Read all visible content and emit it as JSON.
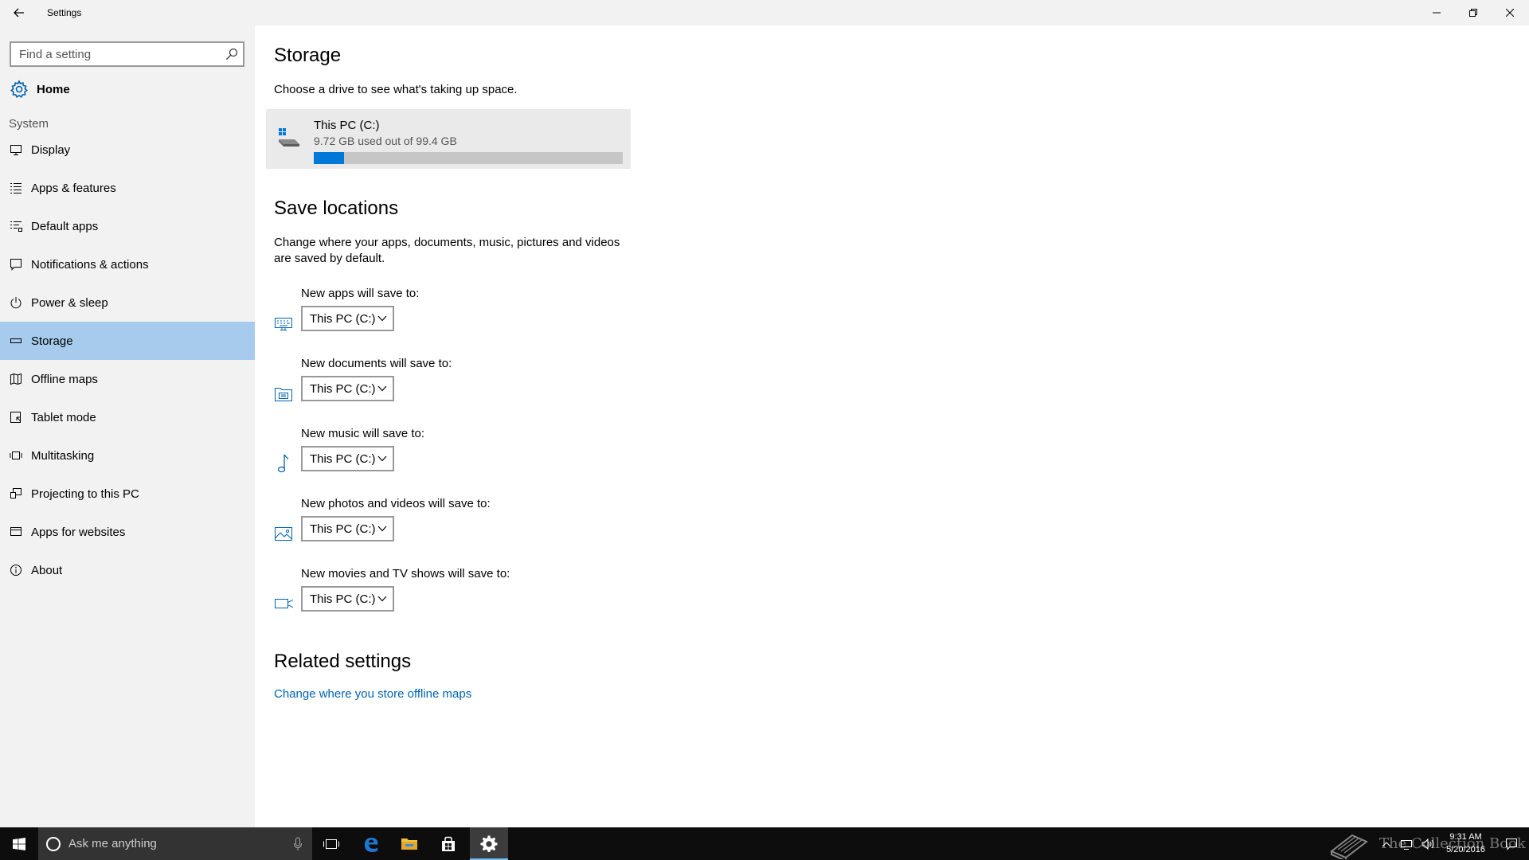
{
  "window": {
    "title": "Settings"
  },
  "sidebar": {
    "search_placeholder": "Find a setting",
    "home_label": "Home",
    "section_label": "System",
    "items": [
      {
        "label": "Display",
        "icon": "display-icon"
      },
      {
        "label": "Apps & features",
        "icon": "list-icon"
      },
      {
        "label": "Default apps",
        "icon": "default-apps-icon"
      },
      {
        "label": "Notifications & actions",
        "icon": "notification-icon"
      },
      {
        "label": "Power & sleep",
        "icon": "power-icon"
      },
      {
        "label": "Storage",
        "icon": "storage-icon",
        "selected": true
      },
      {
        "label": "Offline maps",
        "icon": "map-icon"
      },
      {
        "label": "Tablet mode",
        "icon": "tablet-icon"
      },
      {
        "label": "Multitasking",
        "icon": "multitasking-icon"
      },
      {
        "label": "Projecting to this PC",
        "icon": "projecting-icon"
      },
      {
        "label": "Apps for websites",
        "icon": "apps-websites-icon"
      },
      {
        "label": "About",
        "icon": "info-icon"
      }
    ]
  },
  "main": {
    "title": "Storage",
    "description": "Choose a drive to see what's taking up space.",
    "drive": {
      "name": "This PC (C:)",
      "usage": "9.72 GB used out of 99.4 GB",
      "used_fraction": 0.0978
    },
    "save_locations": {
      "title": "Save locations",
      "description": "Change where your apps, documents, music, pictures and videos are saved by default.",
      "items": [
        {
          "label": "New apps will save to:",
          "value": "This PC (C:)",
          "icon": "apps-keyboard-icon"
        },
        {
          "label": "New documents will save to:",
          "value": "This PC (C:)",
          "icon": "documents-icon"
        },
        {
          "label": "New music will save to:",
          "value": "This PC (C:)",
          "icon": "music-icon"
        },
        {
          "label": "New photos and videos will save to:",
          "value": "This PC (C:)",
          "icon": "photos-icon"
        },
        {
          "label": "New movies and TV shows will save to:",
          "value": "This PC (C:)",
          "icon": "video-icon"
        }
      ]
    },
    "related": {
      "title": "Related settings",
      "link": "Change where you store offline maps"
    }
  },
  "taskbar": {
    "search_placeholder": "Ask me anything",
    "time": "9:31 AM",
    "date": "5/20/2016",
    "watermark": "The Collection Book"
  },
  "colors": {
    "accent": "#0078d7",
    "selected_nav": "#a6cbed",
    "link": "#0063b1",
    "icon_blue": "#0063b1"
  }
}
